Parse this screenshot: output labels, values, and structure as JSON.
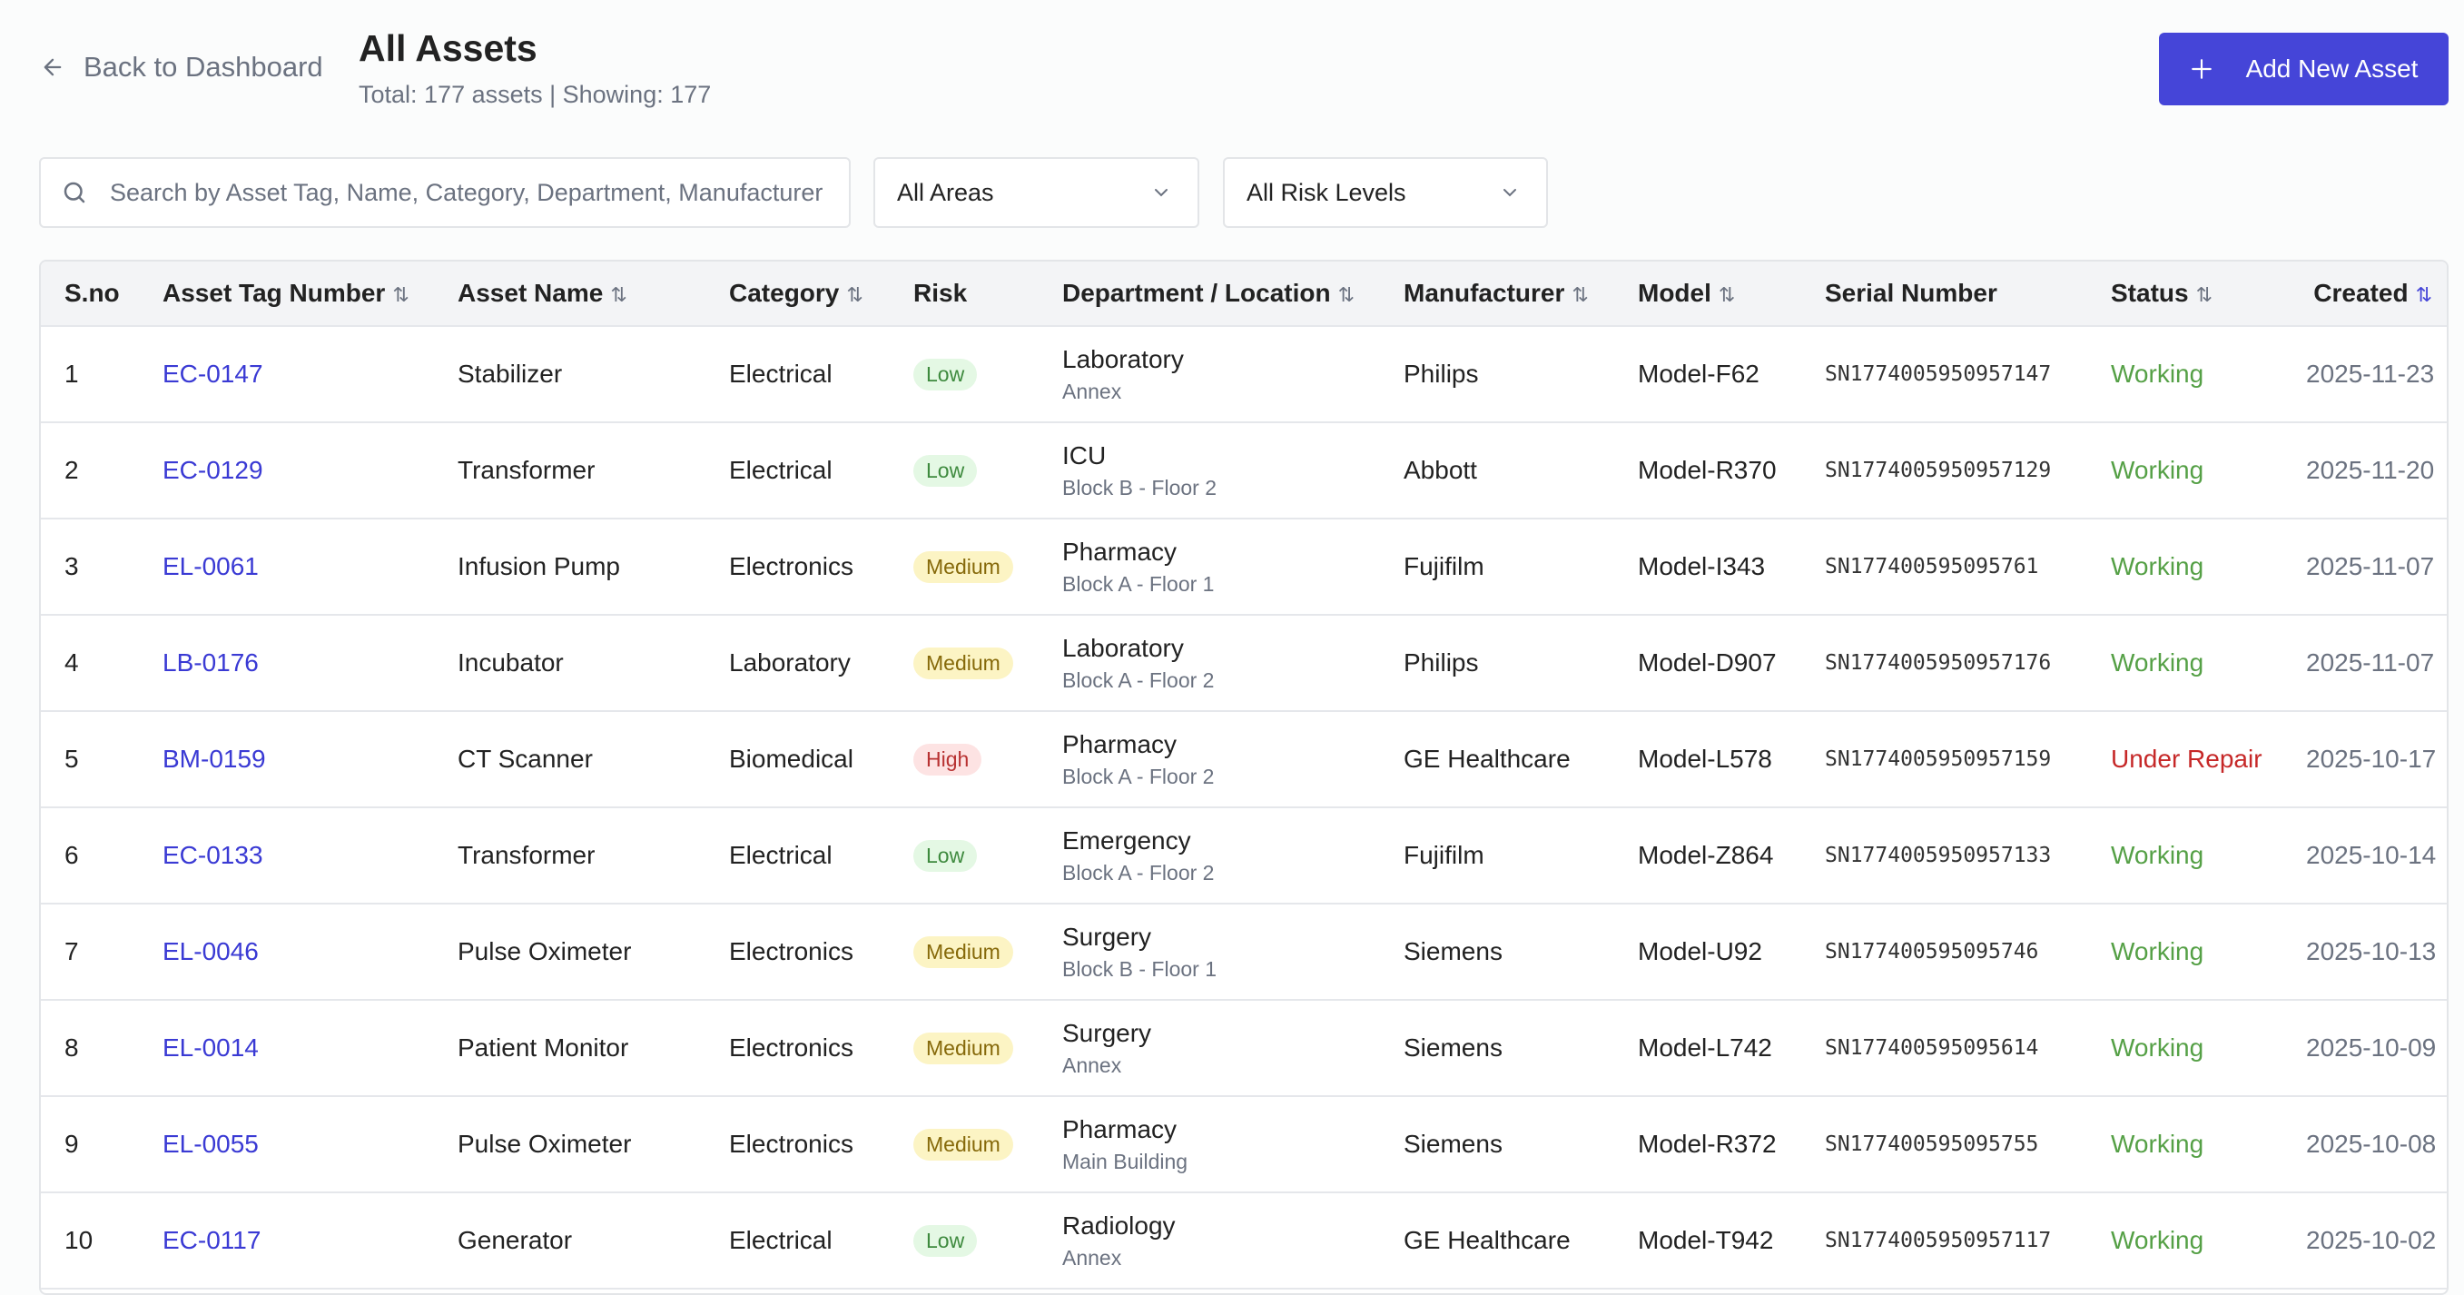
{
  "header": {
    "back_label": "Back to Dashboard",
    "title": "All Assets",
    "subtitle": "Total: 177 assets | Showing: 177",
    "add_label": "Add New Asset"
  },
  "filters": {
    "search_placeholder": "Search by Asset Tag, Name, Category, Department, Manufacturer",
    "area": "All Areas",
    "risk": "All Risk Levels"
  },
  "columns": [
    "S.no",
    "Asset Tag Number",
    "Asset Name",
    "Category",
    "Risk",
    "Department / Location",
    "Manufacturer",
    "Model",
    "Serial Number",
    "Status",
    "Created"
  ],
  "sort_icon": "⇅",
  "colors": {
    "accent": "#4545d8",
    "working": "#55a046",
    "repair": "#c62828"
  },
  "rows": [
    {
      "sno": "1",
      "tag": "EC-0147",
      "name": "Stabilizer",
      "category": "Electrical",
      "risk": "Low",
      "dept": "Laboratory",
      "loc": "Annex",
      "mfr": "Philips",
      "model": "Model-F62",
      "serial": "SN1774005950957147",
      "status": "Working",
      "created": "2025-11-23"
    },
    {
      "sno": "2",
      "tag": "EC-0129",
      "name": "Transformer",
      "category": "Electrical",
      "risk": "Low",
      "dept": "ICU",
      "loc": "Block B - Floor 2",
      "mfr": "Abbott",
      "model": "Model-R370",
      "serial": "SN1774005950957129",
      "status": "Working",
      "created": "2025-11-20"
    },
    {
      "sno": "3",
      "tag": "EL-0061",
      "name": "Infusion Pump",
      "category": "Electronics",
      "risk": "Medium",
      "dept": "Pharmacy",
      "loc": "Block A - Floor 1",
      "mfr": "Fujifilm",
      "model": "Model-I343",
      "serial": "SN177400595095761",
      "status": "Working",
      "created": "2025-11-07"
    },
    {
      "sno": "4",
      "tag": "LB-0176",
      "name": "Incubator",
      "category": "Laboratory",
      "risk": "Medium",
      "dept": "Laboratory",
      "loc": "Block A - Floor 2",
      "mfr": "Philips",
      "model": "Model-D907",
      "serial": "SN1774005950957176",
      "status": "Working",
      "created": "2025-11-07"
    },
    {
      "sno": "5",
      "tag": "BM-0159",
      "name": "CT Scanner",
      "category": "Biomedical",
      "risk": "High",
      "dept": "Pharmacy",
      "loc": "Block A - Floor 2",
      "mfr": "GE Healthcare",
      "model": "Model-L578",
      "serial": "SN1774005950957159",
      "status": "Under Repair",
      "created": "2025-10-17"
    },
    {
      "sno": "6",
      "tag": "EC-0133",
      "name": "Transformer",
      "category": "Electrical",
      "risk": "Low",
      "dept": "Emergency",
      "loc": "Block A - Floor 2",
      "mfr": "Fujifilm",
      "model": "Model-Z864",
      "serial": "SN1774005950957133",
      "status": "Working",
      "created": "2025-10-14"
    },
    {
      "sno": "7",
      "tag": "EL-0046",
      "name": "Pulse Oximeter",
      "category": "Electronics",
      "risk": "Medium",
      "dept": "Surgery",
      "loc": "Block B - Floor 1",
      "mfr": "Siemens",
      "model": "Model-U92",
      "serial": "SN177400595095746",
      "status": "Working",
      "created": "2025-10-13"
    },
    {
      "sno": "8",
      "tag": "EL-0014",
      "name": "Patient Monitor",
      "category": "Electronics",
      "risk": "Medium",
      "dept": "Surgery",
      "loc": "Annex",
      "mfr": "Siemens",
      "model": "Model-L742",
      "serial": "SN177400595095614",
      "status": "Working",
      "created": "2025-10-09"
    },
    {
      "sno": "9",
      "tag": "EL-0055",
      "name": "Pulse Oximeter",
      "category": "Electronics",
      "risk": "Medium",
      "dept": "Pharmacy",
      "loc": "Main Building",
      "mfr": "Siemens",
      "model": "Model-R372",
      "serial": "SN177400595095755",
      "status": "Working",
      "created": "2025-10-08"
    },
    {
      "sno": "10",
      "tag": "EC-0117",
      "name": "Generator",
      "category": "Electrical",
      "risk": "Low",
      "dept": "Radiology",
      "loc": "Annex",
      "mfr": "GE Healthcare",
      "model": "Model-T942",
      "serial": "SN1774005950957117",
      "status": "Working",
      "created": "2025-10-02"
    }
  ]
}
